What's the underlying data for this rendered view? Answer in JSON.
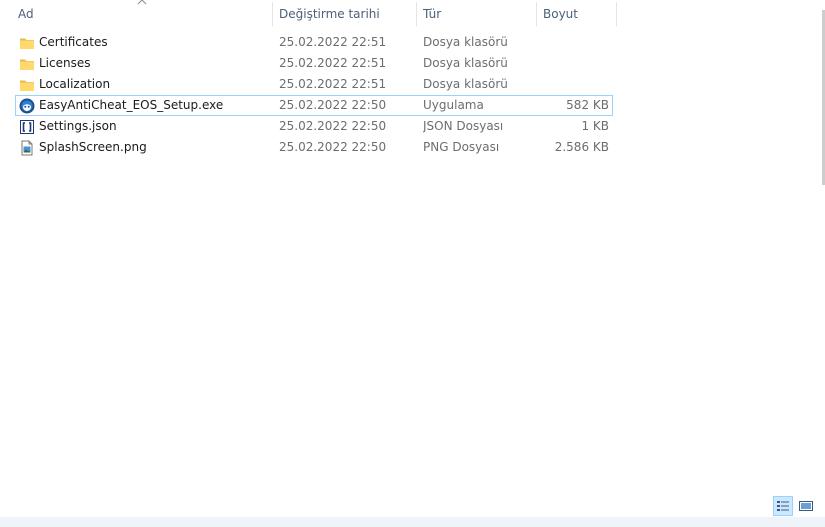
{
  "columns": {
    "name": "Ad",
    "date": "Değiştirme tarihi",
    "type": "Tür",
    "size": "Boyut"
  },
  "files": [
    {
      "name": "Certificates",
      "date": "25.02.2022 22:51",
      "type": "Dosya klasörü",
      "size": "",
      "icon": "folder-icon"
    },
    {
      "name": "Licenses",
      "date": "25.02.2022 22:51",
      "type": "Dosya klasörü",
      "size": "",
      "icon": "folder-icon"
    },
    {
      "name": "Localization",
      "date": "25.02.2022 22:51",
      "type": "Dosya klasörü",
      "size": "",
      "icon": "folder-icon"
    },
    {
      "name": "EasyAntiCheat_EOS_Setup.exe",
      "date": "25.02.2022 22:50",
      "type": "Uygulama",
      "size": "582 KB",
      "icon": "easyanticheat-app-icon"
    },
    {
      "name": "Settings.json",
      "date": "25.02.2022 22:50",
      "type": "JSON Dosyası",
      "size": "1 KB",
      "icon": "json-file-icon"
    },
    {
      "name": "SplashScreen.png",
      "date": "25.02.2022 22:50",
      "type": "PNG Dosyası",
      "size": "2.586 KB",
      "icon": "png-file-icon"
    }
  ],
  "colors": {
    "header_text": "#4c607a",
    "focus_border": "#99d1ff",
    "selected_bg": "#cce8ff",
    "folder": "#ffd86e"
  }
}
